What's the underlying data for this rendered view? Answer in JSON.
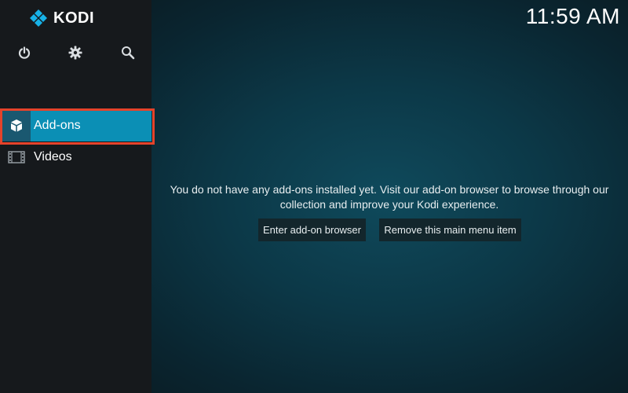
{
  "app": {
    "name": "KODI"
  },
  "clock": {
    "time": "11:59 AM"
  },
  "top_icons": [
    {
      "name": "power-icon"
    },
    {
      "name": "gear-icon"
    },
    {
      "name": "search-icon"
    }
  ],
  "menu": {
    "items": [
      {
        "label": "Add-ons",
        "icon": "addons-box-icon",
        "selected": true
      },
      {
        "label": "Videos",
        "icon": "film-strip-icon",
        "selected": false
      }
    ]
  },
  "main": {
    "message": "You do not have any add-ons installed yet. Visit our add-on browser to browse through our collection and improve your Kodi experience.",
    "buttons": {
      "browse_label": "Enter add-on browser",
      "remove_label": "Remove this main menu item"
    }
  },
  "colors": {
    "selected_item_bg": "#0b8fb5",
    "selection_outline": "#e5432b",
    "sidebar_bg": "#16191c",
    "logo_accent": "#17b2e7"
  }
}
